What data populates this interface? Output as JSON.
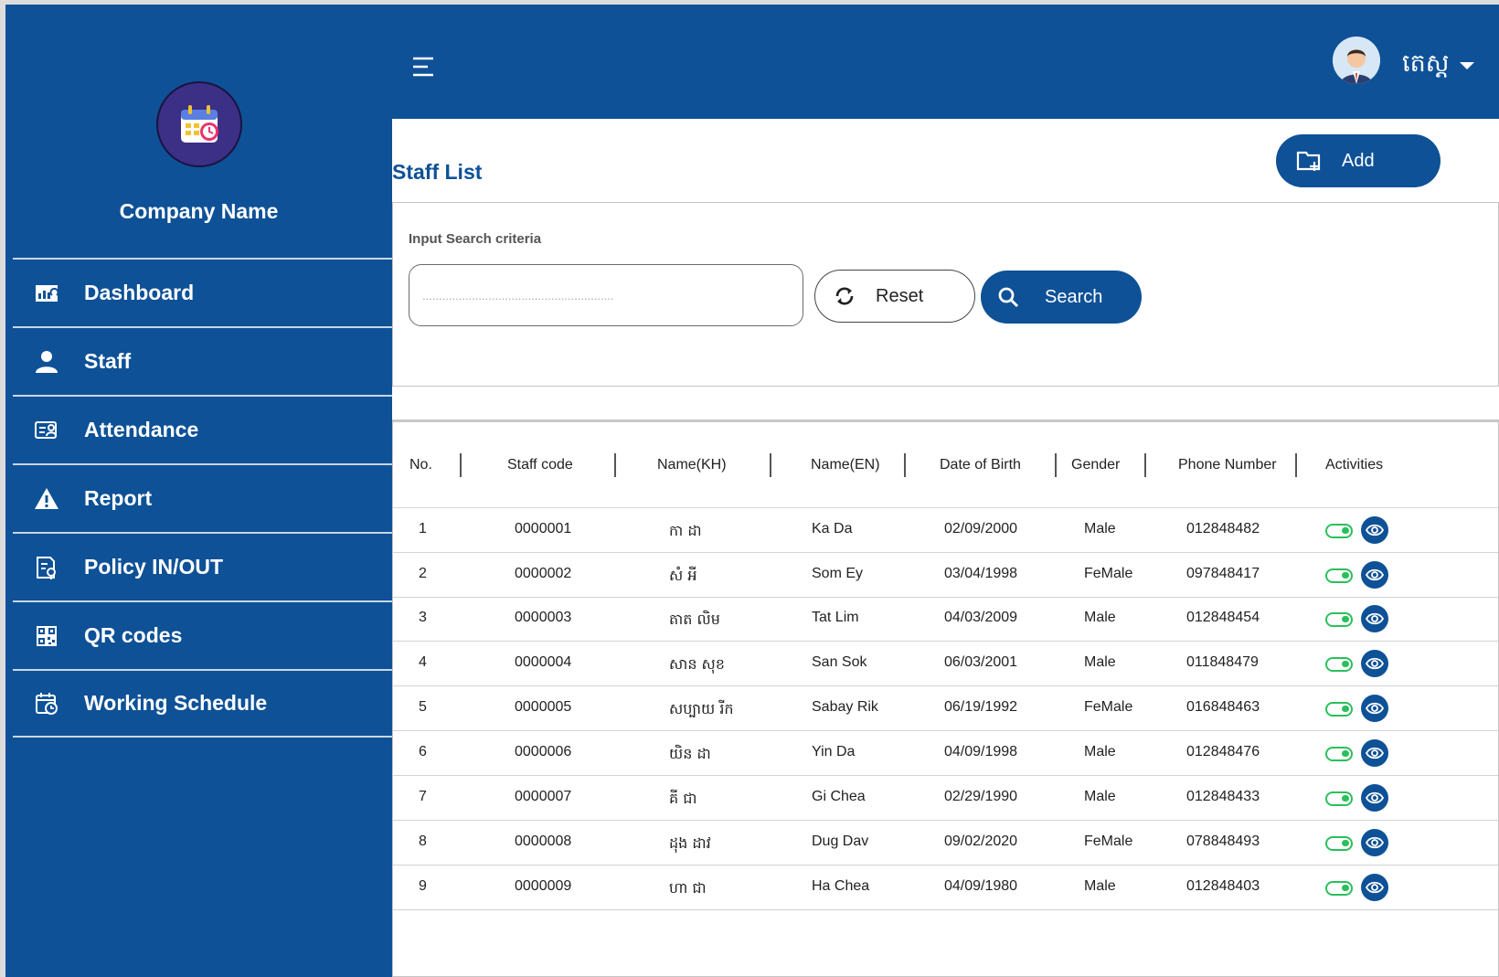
{
  "sidebar": {
    "company_name": "Company Name",
    "items": [
      {
        "label": "Dashboard",
        "icon": "dashboard-icon"
      },
      {
        "label": "Staff",
        "icon": "person-icon"
      },
      {
        "label": "Attendance",
        "icon": "attendance-icon"
      },
      {
        "label": "Report",
        "icon": "warning-icon"
      },
      {
        "label": "Policy IN/OUT",
        "icon": "policy-icon"
      },
      {
        "label": "QR codes",
        "icon": "qr-code-icon"
      },
      {
        "label": "Working Schedule",
        "icon": "schedule-icon"
      }
    ]
  },
  "header": {
    "username": "តេស្ត"
  },
  "page": {
    "title": "Staff List",
    "add_label": "Add"
  },
  "search": {
    "criteria_label": "Input Search criteria",
    "placeholder": "..........................................................",
    "reset_label": "Reset",
    "search_label": "Search"
  },
  "table": {
    "columns": [
      "No.",
      "Staff code",
      "Name(KH)",
      "Name(EN)",
      "Date of Birth",
      "Gender",
      "Phone Number",
      "Activities"
    ],
    "rows": [
      {
        "no": "1",
        "code": "0000001",
        "name_kh": "កា ដា",
        "name_en": "Ka   Da",
        "dob": "02/09/2000",
        "gender": "Male",
        "phone": "012848482"
      },
      {
        "no": "2",
        "code": "0000002",
        "name_kh": "សំ អី",
        "name_en": "Som   Ey",
        "dob": "03/04/1998",
        "gender": "FeMale",
        "phone": "097848417"
      },
      {
        "no": "3",
        "code": "0000003",
        "name_kh": "តាត លិម",
        "name_en": "Tat   Lim",
        "dob": "04/03/2009",
        "gender": "Male",
        "phone": "012848454"
      },
      {
        "no": "4",
        "code": "0000004",
        "name_kh": "សាន សុខ",
        "name_en": "San   Sok",
        "dob": "06/03/2001",
        "gender": "Male",
        "phone": "011848479"
      },
      {
        "no": "5",
        "code": "0000005",
        "name_kh": "សប្បាយ រីក",
        "name_en": "Sabay   Rik",
        "dob": "06/19/1992",
        "gender": "FeMale",
        "phone": "016848463"
      },
      {
        "no": "6",
        "code": "0000006",
        "name_kh": "យិន ដា",
        "name_en": "Yin   Da",
        "dob": "04/09/1998",
        "gender": "Male",
        "phone": "012848476"
      },
      {
        "no": "7",
        "code": "0000007",
        "name_kh": "គី ជា",
        "name_en": "Gi   Chea",
        "dob": "02/29/1990",
        "gender": "Male",
        "phone": "012848433"
      },
      {
        "no": "8",
        "code": "0000008",
        "name_kh": "ដុង ដាវ",
        "name_en": "Dug   Dav",
        "dob": "09/02/2020",
        "gender": "FeMale",
        "phone": "078848493"
      },
      {
        "no": "9",
        "code": "0000009",
        "name_kh": "ហា ជា",
        "name_en": "Ha   Chea",
        "dob": "04/09/1980",
        "gender": "Male",
        "phone": "012848403"
      }
    ]
  },
  "colors": {
    "primary": "#0e5197",
    "toggle": "#2bbf5b",
    "logo_bg": "#3b2f86"
  }
}
